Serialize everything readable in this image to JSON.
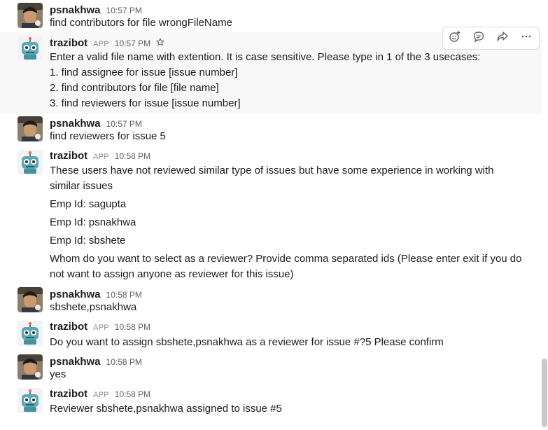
{
  "users": {
    "human": "psnakhwa",
    "bot": "trazibot",
    "app_tag": "APP"
  },
  "messages": [
    {
      "sender": "psnakhwa",
      "time": "10:57 PM",
      "lines": [
        "find contributors for file wrongFileName"
      ]
    },
    {
      "sender": "trazibot",
      "app": "APP",
      "time": "10:57 PM",
      "lines": [
        "Enter a valid file name with extention. It is case sensitive. Please type in 1 of the 3 usecases:",
        "1. find assignee for issue [issue number]",
        "2. find contributors for file [file name]",
        "3. find reviewers for issue [issue number]"
      ]
    },
    {
      "sender": "psnakhwa",
      "time": "10:57 PM",
      "lines": [
        "find reviewers for issue 5"
      ]
    },
    {
      "sender": "trazibot",
      "app": "APP",
      "time": "10:58 PM",
      "lines": [
        "These users have not reviewed similar type of issues but have some experience in working with",
        "similar issues",
        "Emp Id: sagupta",
        "Emp Id: psnakhwa",
        "Emp Id: sbshete",
        "Whom do you want to select as a reviewer? Provide comma separated ids (Please enter exit if you do",
        "not want to assign anyone as reviewer for this issue)"
      ]
    },
    {
      "sender": "psnakhwa",
      "time": "10:58 PM",
      "lines": [
        "sbshete,psnakhwa"
      ]
    },
    {
      "sender": "trazibot",
      "app": "APP",
      "time": "10:58 PM",
      "lines": [
        "Do you want to assign sbshete,psnakhwa as a reviewer for issue #?5 Please confirm"
      ]
    },
    {
      "sender": "psnakhwa",
      "time": "10:58 PM",
      "lines": [
        "yes"
      ]
    },
    {
      "sender": "trazibot",
      "app": "APP",
      "time": "10:58 PM",
      "lines": [
        "Reviewer sbshete,psnakhwa assigned to issue #5"
      ]
    }
  ],
  "toolbar": {
    "icons": [
      "add-reaction-icon",
      "reply-in-thread-icon",
      "share-message-icon",
      "more-actions-icon"
    ]
  },
  "colors": {
    "hover_background": "#f8f8f8",
    "text": "#1d1c1d",
    "meta_text": "#616061",
    "bot_avatar": "#5aa9b5"
  }
}
